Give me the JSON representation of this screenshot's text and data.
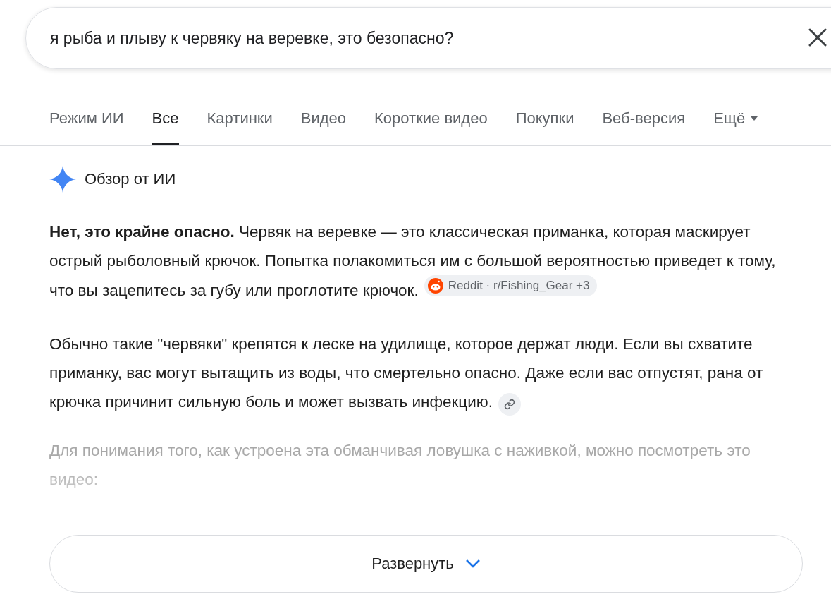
{
  "search": {
    "value": "я рыба и плыву к червяку на веревке, это безопасно?"
  },
  "tabs": [
    {
      "label": "Режим ИИ",
      "selected": false
    },
    {
      "label": "Все",
      "selected": true
    },
    {
      "label": "Картинки",
      "selected": false
    },
    {
      "label": "Видео",
      "selected": false
    },
    {
      "label": "Короткие видео",
      "selected": false
    },
    {
      "label": "Покупки",
      "selected": false
    },
    {
      "label": "Веб-версия",
      "selected": false
    },
    {
      "label": "Ещё",
      "selected": false,
      "dropdown": true
    }
  ],
  "ai_overview": {
    "title": "Обзор от ИИ",
    "paragraphs": [
      {
        "text": "**Нет, это крайне опасно.** Червяк на веревке — это классическая приманка, которая маскирует острый рыболовный крючок. Попытка полакомиться им с большой вероятностью приведет к тому, что вы зацепитесь за губу или проглотите крючок.",
        "faded": false,
        "source": {
          "kind": "reddit",
          "label": "Reddit · r/Fishing_Gear +3"
        }
      },
      {
        "text": "Обычно такие \"червяки\" крепятся к леске на удилище, которое держат люди. Если вы схватите приманку, вас могут вытащить из воды, что смертельно опасно. Даже если вас отпустят, рана от крючка причинит сильную боль и может вызвать инфекцию.",
        "faded": false,
        "source": {
          "kind": "link"
        }
      },
      {
        "text": "Для понимания того, как устроена эта обманчивая ловушка с наживкой, можно посмотреть это видео:",
        "faded": true
      }
    ],
    "expand_button": "Развернуть"
  }
}
